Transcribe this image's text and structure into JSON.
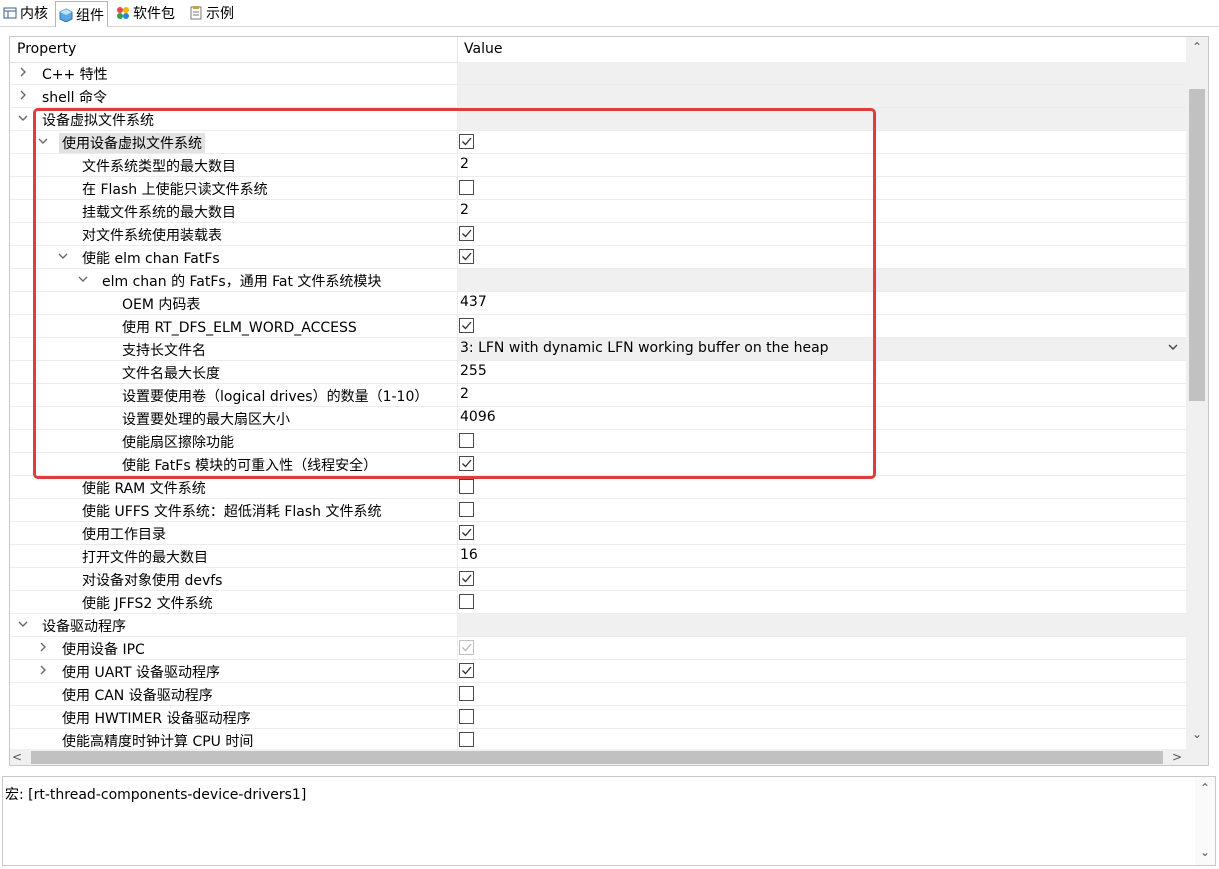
{
  "tabs": [
    {
      "label": "内核",
      "icon": "kernel-icon"
    },
    {
      "label": "组件",
      "icon": "component-icon"
    },
    {
      "label": "软件包",
      "icon": "package-icon"
    },
    {
      "label": "示例",
      "icon": "example-icon"
    }
  ],
  "header": {
    "property": "Property",
    "value": "Value"
  },
  "rows": [
    {
      "label": "C++ 特性",
      "twisty": "collapsed",
      "kind": "cat"
    },
    {
      "label": "shell 命令",
      "twisty": "collapsed",
      "kind": "cat"
    },
    {
      "label": "设备虚拟文件系统",
      "twisty": "expanded",
      "kind": "cat"
    },
    {
      "label": "使用设备虚拟文件系统",
      "twisty": "expanded",
      "checked": true,
      "selected": true
    },
    {
      "label": "文件系统类型的最大数目",
      "value": "2"
    },
    {
      "label": "在 Flash 上使能只读文件系统",
      "checked": false
    },
    {
      "label": "挂载文件系统的最大数目",
      "value": "2"
    },
    {
      "label": "对文件系统使用装载表",
      "checked": true
    },
    {
      "label": "使能 elm chan FatFs",
      "twisty": "expanded",
      "checked": true
    },
    {
      "label": "elm chan 的 FatFs，通用 Fat 文件系统模块",
      "twisty": "expanded",
      "kind": "cat"
    },
    {
      "label": "OEM 内码表",
      "value": "437"
    },
    {
      "label": "使用 RT_DFS_ELM_WORD_ACCESS",
      "checked": true
    },
    {
      "label": "支持长文件名",
      "value": "3: LFN with dynamic LFN working buffer on the heap",
      "combo": true
    },
    {
      "label": "文件名最大长度",
      "value": "255"
    },
    {
      "label": "设置要使用卷（logical drives）的数量（1-10）",
      "value": "2"
    },
    {
      "label": "设置要处理的最大扇区大小",
      "value": "4096"
    },
    {
      "label": "使能扇区擦除功能",
      "checked": false
    },
    {
      "label": "使能 FatFs 模块的可重入性（线程安全）",
      "checked": true
    },
    {
      "label": "使能 RAM 文件系统",
      "checked": false
    },
    {
      "label": "使能 UFFS 文件系统：超低消耗 Flash 文件系统",
      "checked": false
    },
    {
      "label": "使用工作目录",
      "checked": true
    },
    {
      "label": "打开文件的最大数目",
      "value": "16"
    },
    {
      "label": "对设备对象使用 devfs",
      "checked": true
    },
    {
      "label": "使能 JFFS2 文件系统",
      "checked": false
    },
    {
      "label": "设备驱动程序",
      "twisty": "expanded",
      "kind": "cat"
    },
    {
      "label": "使用设备 IPC",
      "twisty": "collapsed",
      "checked": true,
      "disabled": true
    },
    {
      "label": "使用 UART 设备驱动程序",
      "twisty": "collapsed",
      "checked": true
    },
    {
      "label": "使用 CAN 设备驱动程序",
      "checked": false
    },
    {
      "label": "使用 HWTIMER 设备驱动程序",
      "checked": false
    },
    {
      "label": "使能高精度时钟计算 CPU 时间",
      "checked": false
    }
  ],
  "macro": {
    "text": "宏: [rt-thread-components-device-drivers1]"
  },
  "colors": {
    "highlight": "#e23b3b",
    "category_bg": "#f0f0f0",
    "selection_bg": "#e2e2e2"
  }
}
